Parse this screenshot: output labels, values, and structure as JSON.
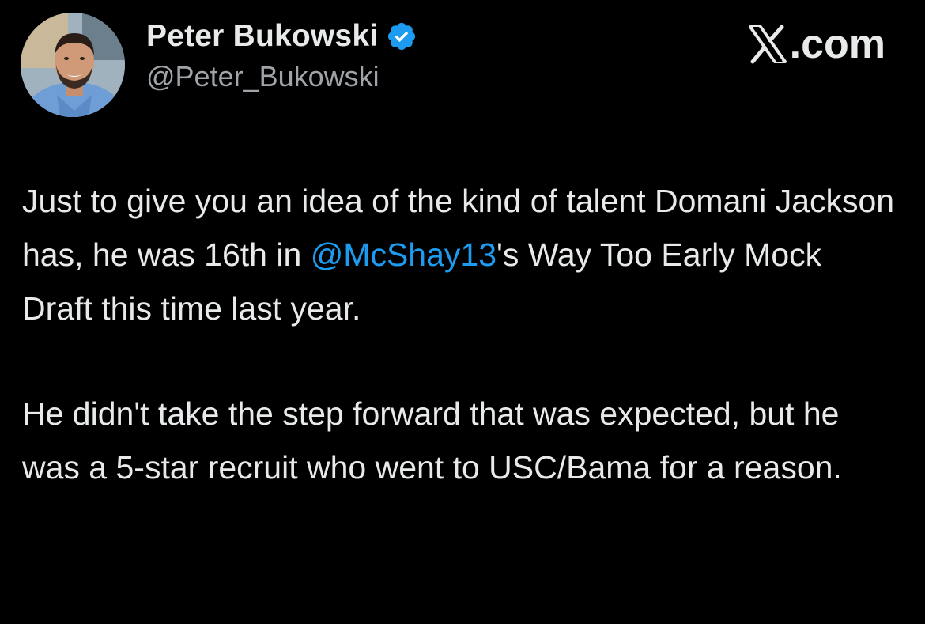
{
  "author": {
    "name": "Peter Bukowski",
    "handle": "@Peter_Bukowski",
    "verified": true
  },
  "site": {
    "label": ".com"
  },
  "tweet": {
    "paragraph1": {
      "text_before": "Just to give you an idea of the kind of talent Domani Jackson has, he was 16th in ",
      "mention": "@McShay13",
      "text_after": "'s Way Too Early Mock Draft this time last year."
    },
    "paragraph2": {
      "text": "He didn't take the step forward that was expected, but he was a 5-star recruit who went to USC/Bama for a reason."
    }
  },
  "colors": {
    "background": "#000000",
    "text": "#e7e9ea",
    "handle": "#a0a4a8",
    "mention": "#1d9bf0",
    "verified": "#1d9bf0"
  },
  "icons": {
    "verified": "verified-badge-icon",
    "brand": "x-logo-icon"
  }
}
